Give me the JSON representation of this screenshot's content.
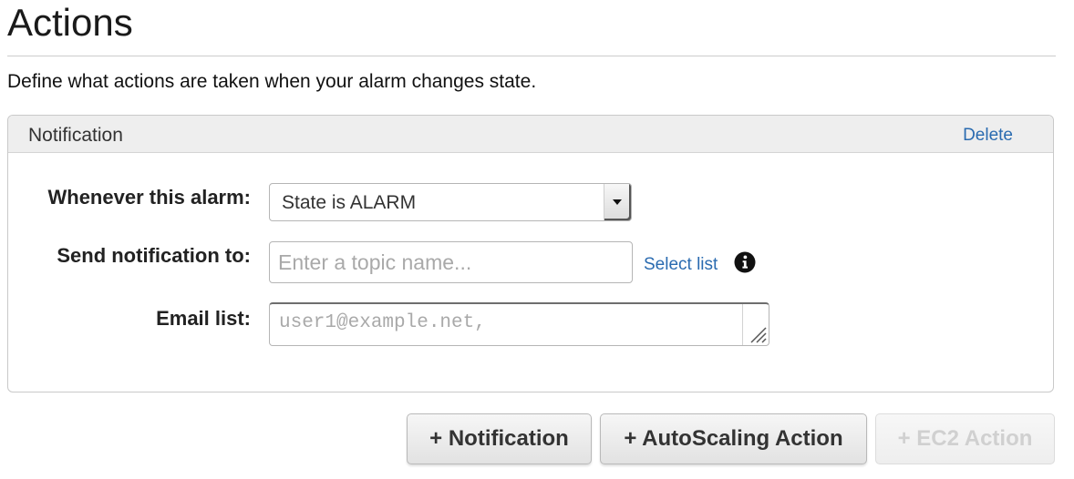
{
  "header": {
    "title": "Actions",
    "description": "Define what actions are taken when your alarm changes state."
  },
  "notification_panel": {
    "title": "Notification",
    "delete_label": "Delete",
    "alarm_state": {
      "label": "Whenever this alarm:",
      "selected_value": "State is ALARM"
    },
    "send_to": {
      "label": "Send notification to:",
      "value": "",
      "placeholder": "Enter a topic name...",
      "select_list_label": "Select list",
      "info_icon": "info-circle-icon"
    },
    "email_list": {
      "label": "Email list:",
      "value": "",
      "placeholder": "user1@example.net,"
    }
  },
  "action_buttons": {
    "notification": "+ Notification",
    "autoscaling": "+ AutoScaling Action",
    "ec2": "+ EC2 Action"
  },
  "colors": {
    "link": "#2a6bb0",
    "panel_header_bg": "#eeeeee",
    "disabled_text": "#d0d0d0"
  }
}
